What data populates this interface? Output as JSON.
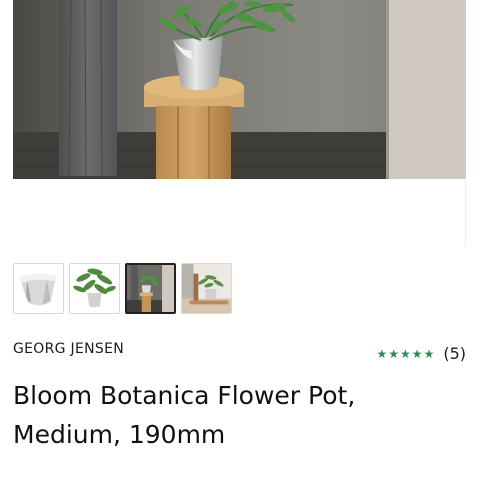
{
  "product": {
    "brand": "GEORG JENSEN",
    "rating_stars": "★★★★★",
    "review_count": "(5)",
    "title": "Bloom Botanica Flower Pot, Medium, 190mm"
  },
  "gallery": {
    "thumbnails": [
      {
        "name": "thumb-pot-only",
        "selected": false
      },
      {
        "name": "thumb-pot-with-plant",
        "selected": false
      },
      {
        "name": "thumb-pot-on-stool",
        "selected": true
      },
      {
        "name": "thumb-pot-on-shelf",
        "selected": false
      }
    ]
  },
  "colors": {
    "star": "#2e8b57",
    "selected_border": "#222222"
  }
}
